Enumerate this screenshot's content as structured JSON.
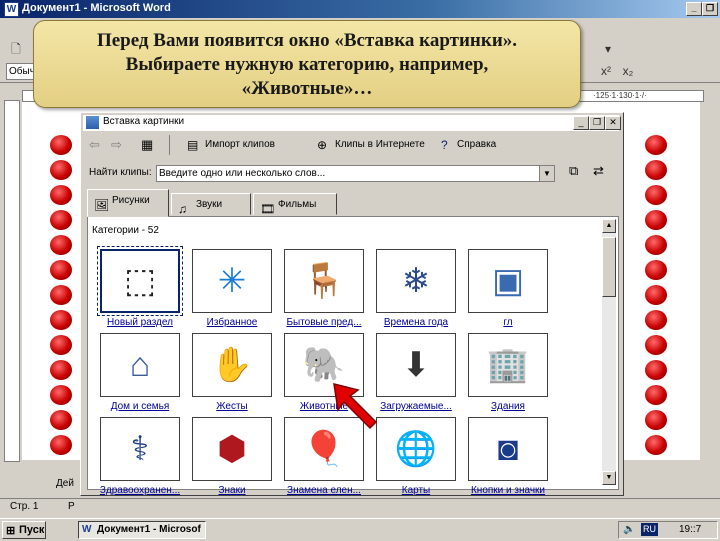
{
  "word": {
    "title": "Документ1 - Microsoft Word",
    "style_value": "Обыч",
    "ruler_tail": "·125·1·130·1·/·",
    "status_page": "Стр. 1",
    "status_tail": "Р",
    "left_partial": "Дей"
  },
  "callout": {
    "line1": "Перед Вами появится окно «Вставка картинки».",
    "line2": "Выбираете нужную категорию, например,",
    "line3": "«Животные»…"
  },
  "dialog": {
    "title": "Вставка картинки",
    "toolbar": {
      "import_label": "Импорт клипов",
      "web_label": "Клипы в Интернете",
      "help_label": "Справка"
    },
    "search_label": "Найти клипы:",
    "search_placeholder": "Введите одно или несколько слов...",
    "tabs": [
      "Рисунки",
      "Звуки",
      "Фильмы"
    ],
    "categories_header": "Категории - 52",
    "categories": [
      {
        "label": "Новый раздел",
        "icon": "new-folder-icon"
      },
      {
        "label": "Избранное",
        "icon": "star-icon"
      },
      {
        "label": "Бытовые пред...",
        "icon": "household-icon"
      },
      {
        "label": "Времена года",
        "icon": "snowflake-icon"
      },
      {
        "label": "гл",
        "icon": "frame-icon"
      },
      {
        "label": "Дом и семья",
        "icon": "house-icon"
      },
      {
        "label": "Жесты",
        "icon": "hand-icon"
      },
      {
        "label": "Животные",
        "icon": "elephant-icon"
      },
      {
        "label": "Загружаемые...",
        "icon": "download-icon"
      },
      {
        "label": "Здания",
        "icon": "buildings-icon"
      },
      {
        "label": "Здравоохранен...",
        "icon": "caduceus-icon"
      },
      {
        "label": "Знаки",
        "icon": "sign-icon"
      },
      {
        "label": "Знамена елен...",
        "icon": "balloons-icon"
      },
      {
        "label": "Карты",
        "icon": "globe-icon"
      },
      {
        "label": "Кнопки и значки",
        "icon": "button-icon"
      }
    ]
  },
  "taskbar": {
    "start_label": "Пуск",
    "task_label": "Документ1 - Microsof",
    "lang": "RU",
    "clock": "19::7"
  }
}
